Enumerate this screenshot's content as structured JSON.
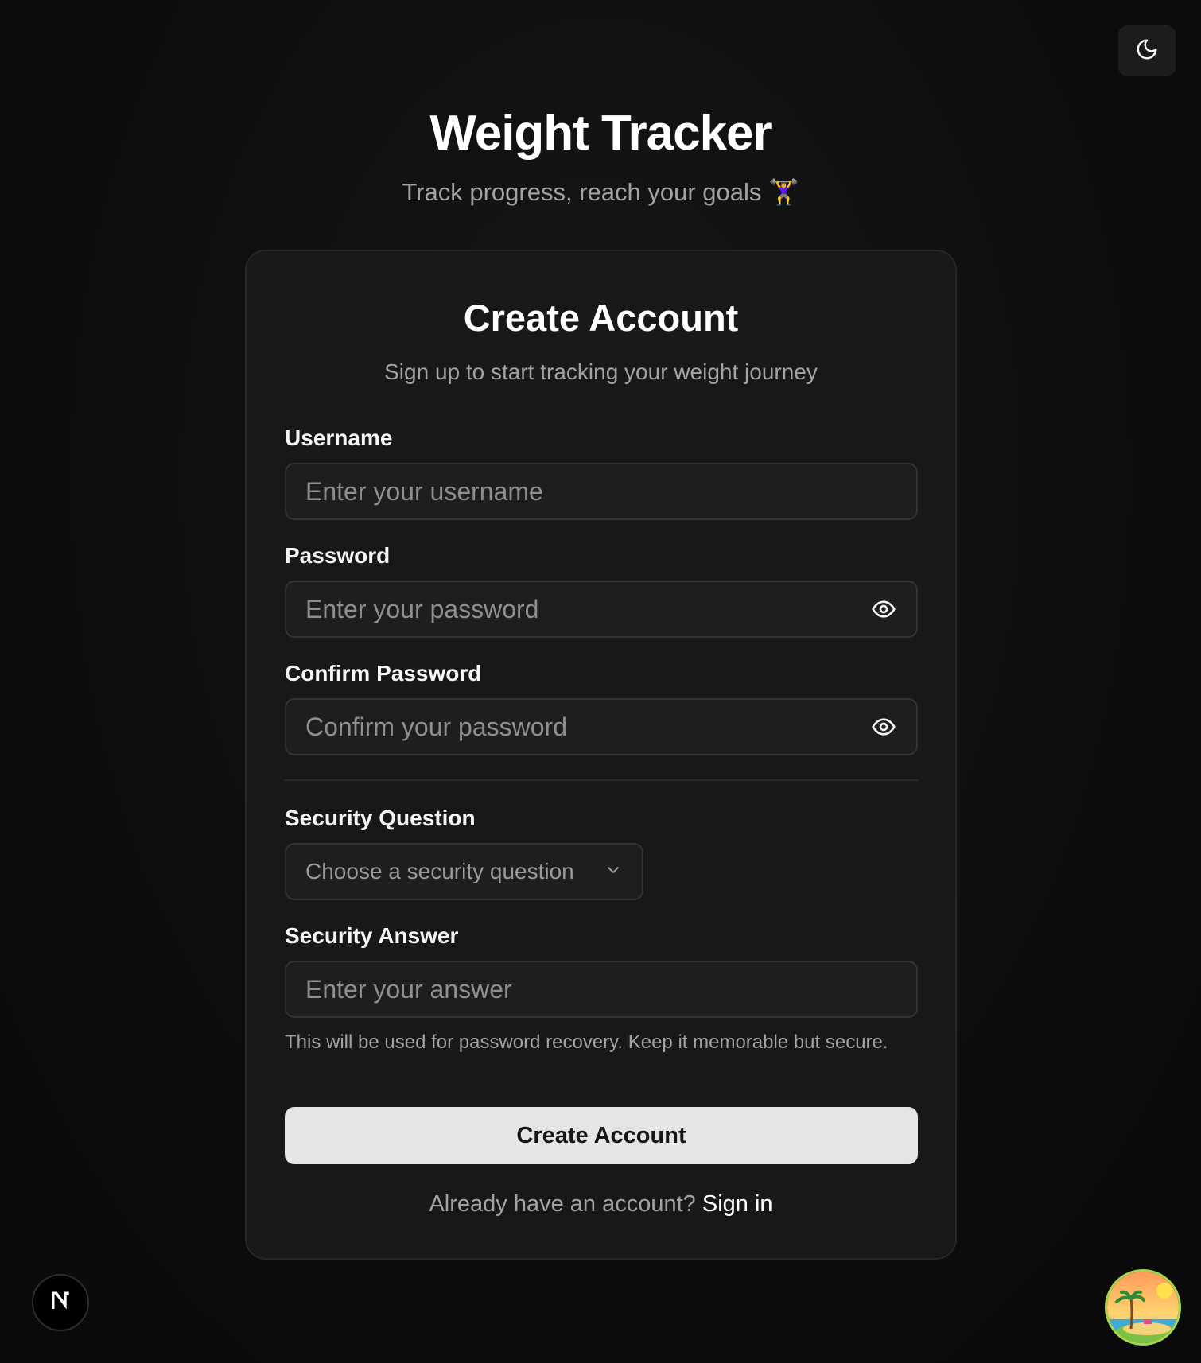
{
  "header": {
    "title": "Weight Tracker",
    "subtitle": "Track progress, reach your goals 🏋️‍♀️"
  },
  "theme_toggle": {
    "icon": "moon-icon"
  },
  "card": {
    "title": "Create Account",
    "description": "Sign up to start tracking your weight journey",
    "username": {
      "label": "Username",
      "placeholder": "Enter your username",
      "value": ""
    },
    "password": {
      "label": "Password",
      "placeholder": "Enter your password",
      "value": "",
      "icon": "eye-icon"
    },
    "confirm_password": {
      "label": "Confirm Password",
      "placeholder": "Confirm your password",
      "value": "",
      "icon": "eye-icon"
    },
    "security_question": {
      "label": "Security Question",
      "selected": "Choose a security question",
      "icon": "chevron-down-icon"
    },
    "security_answer": {
      "label": "Security Answer",
      "placeholder": "Enter your answer",
      "value": ""
    },
    "hint": "This will be used for password recovery. Keep it memorable but secure.",
    "submit_label": "Create Account",
    "signin_prompt": "Already have an account?",
    "signin_link": "Sign in"
  },
  "corner": {
    "next_badge_letter": "N",
    "avatar": "beach-avatar-icon"
  },
  "colors": {
    "background": "#0d0d0d",
    "card": "#181818",
    "primary_button": "#e5e5e5",
    "muted_text": "#a3a3a3"
  }
}
